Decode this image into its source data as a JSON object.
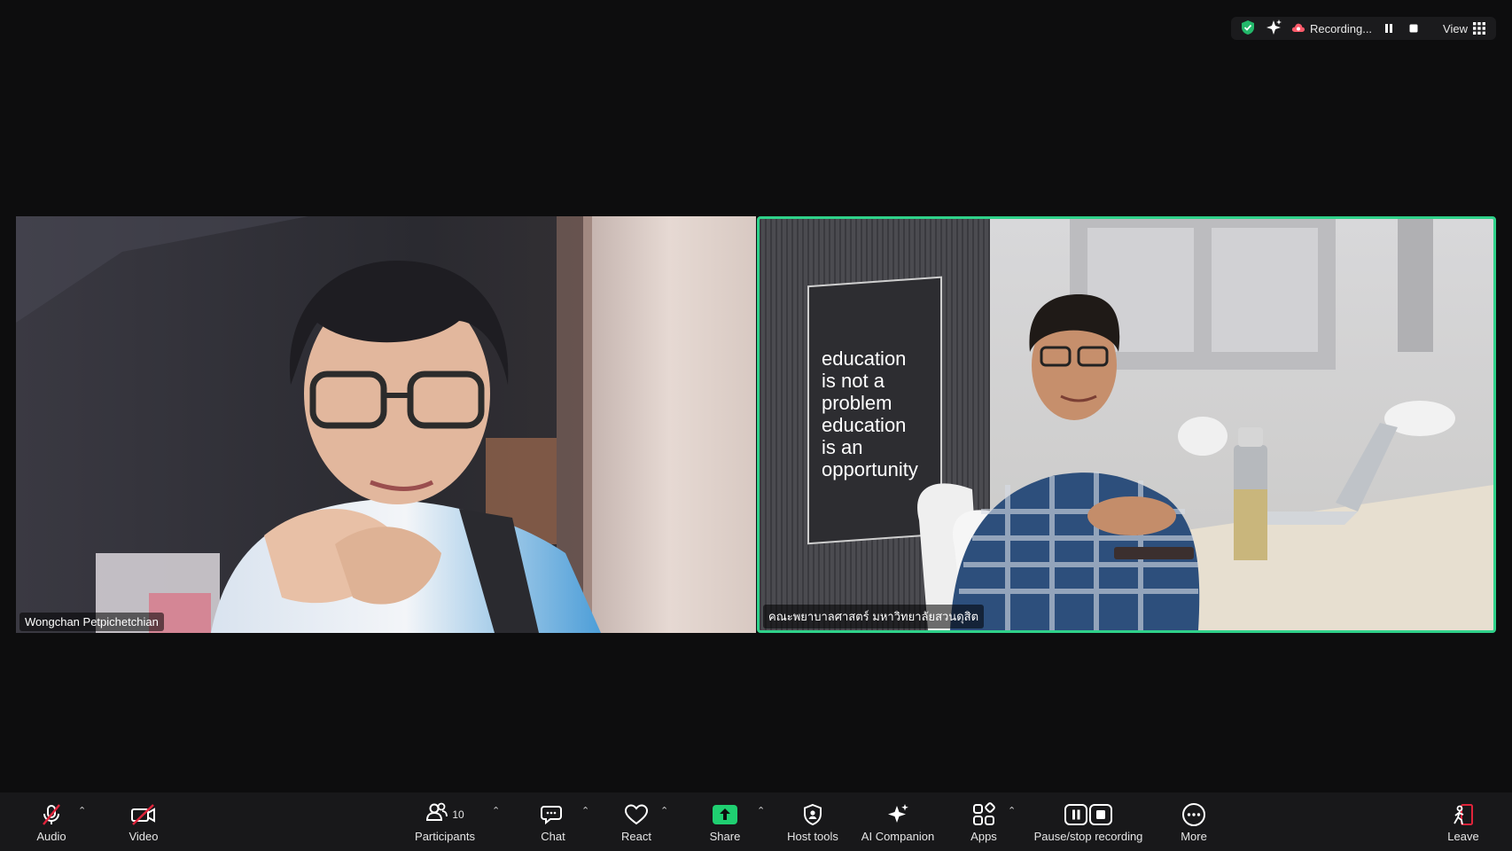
{
  "status_bar": {
    "recording_label": "Recording...",
    "view_label": "View",
    "icons": [
      "shield-check-icon",
      "sparkle-icon",
      "cloud-recording-icon",
      "pause-icon",
      "stop-icon",
      "grid-icon"
    ],
    "accent_color": "#2fd18a"
  },
  "participants": [
    {
      "name": "Wongchan Petpichetchian",
      "active_speaker": false
    },
    {
      "name": "คณะพยาบาลศาสตร์ มหาวิทยาลัยสวนดุสิต",
      "active_speaker": true
    }
  ],
  "poster_text": [
    "education",
    "is not a",
    "problem",
    "education",
    "is an",
    "opportunity"
  ],
  "toolbar": {
    "audio": "Audio",
    "video": "Video",
    "participants": "Participants",
    "participants_count": "10",
    "chat": "Chat",
    "react": "React",
    "share": "Share",
    "host_tools": "Host tools",
    "ai_companion": "AI Companion",
    "apps": "Apps",
    "pause_stop_recording": "Pause/stop recording",
    "more": "More",
    "leave": "Leave",
    "share_color": "#1fcf71",
    "muted_color": "#e0243b"
  }
}
